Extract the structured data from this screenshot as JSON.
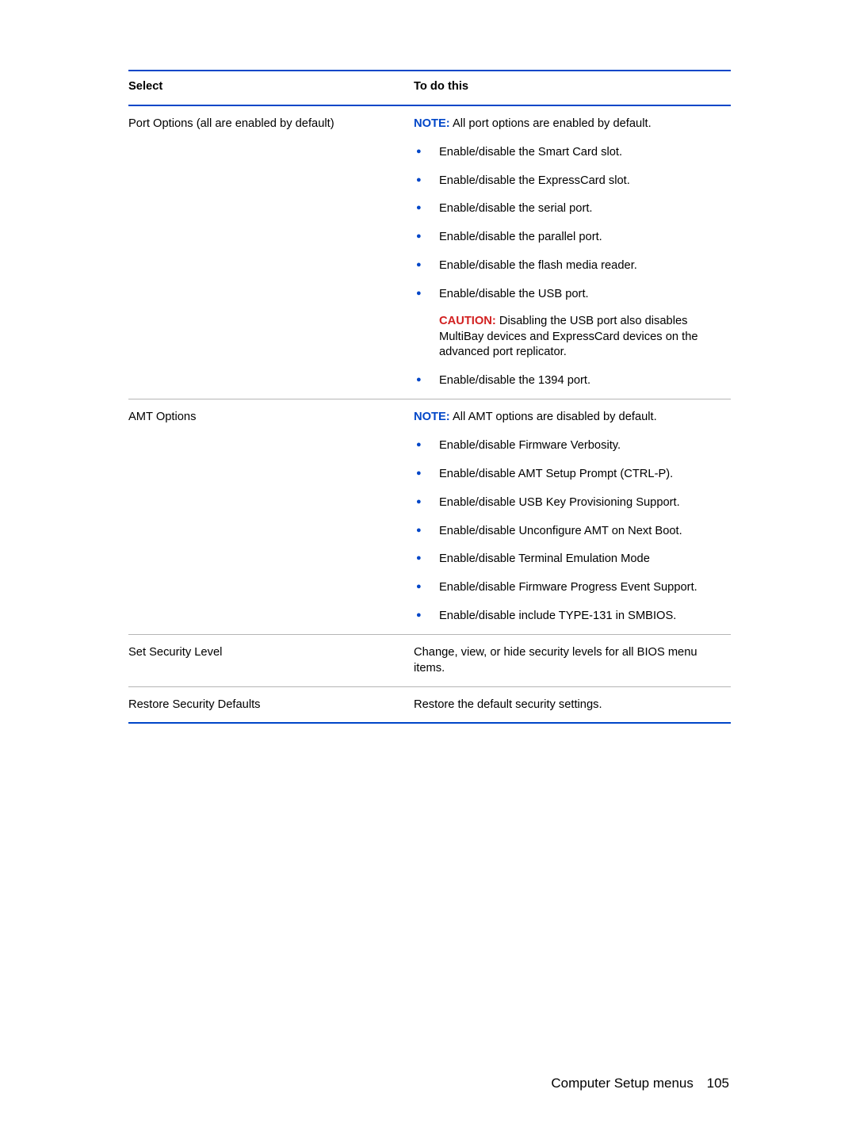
{
  "header": {
    "select": "Select",
    "todo": "To do this"
  },
  "rows": [
    {
      "select": "Port Options (all are enabled by default)",
      "note_label": "NOTE:",
      "note_text": "All port options are enabled by default.",
      "bullets": [
        {
          "text": "Enable/disable the Smart Card slot."
        },
        {
          "text": "Enable/disable the ExpressCard slot."
        },
        {
          "text": "Enable/disable the serial port."
        },
        {
          "text": "Enable/disable the parallel port."
        },
        {
          "text": "Enable/disable the flash media reader."
        },
        {
          "text": "Enable/disable the USB port.",
          "sub_caution_label": "CAUTION:",
          "sub_text": "Disabling the USB port also disables MultiBay devices and ExpressCard devices on the advanced port replicator."
        },
        {
          "text": "Enable/disable the 1394 port."
        }
      ]
    },
    {
      "select": "AMT Options",
      "note_label": "NOTE:",
      "note_text": "All AMT options are disabled by default.",
      "bullets": [
        {
          "text": "Enable/disable Firmware Verbosity."
        },
        {
          "text": "Enable/disable AMT Setup Prompt (CTRL-P)."
        },
        {
          "text": "Enable/disable USB Key Provisioning Support."
        },
        {
          "text": "Enable/disable Unconfigure AMT on Next Boot."
        },
        {
          "text": "Enable/disable Terminal Emulation Mode"
        },
        {
          "text": "Enable/disable Firmware Progress Event Support."
        },
        {
          "text": "Enable/disable include TYPE-131 in SMBIOS."
        }
      ]
    },
    {
      "select": "Set Security Level",
      "plain": "Change, view, or hide security levels for all BIOS menu items."
    },
    {
      "select": "Restore Security Defaults",
      "plain": "Restore the default security settings."
    }
  ],
  "footer": {
    "title": "Computer Setup menus",
    "page": "105"
  }
}
